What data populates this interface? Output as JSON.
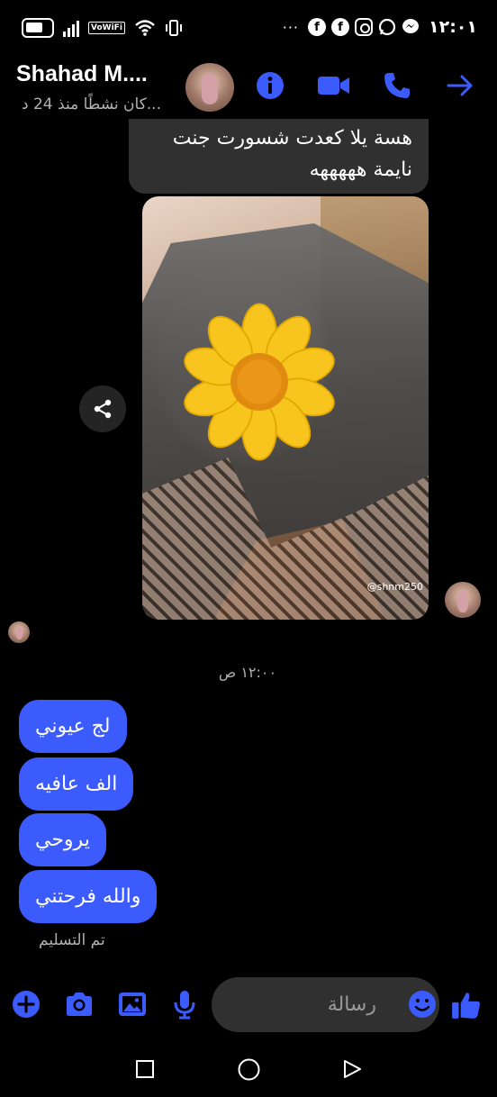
{
  "status_bar": {
    "vowifi": "VoWiFi",
    "time": "١٢:٠١",
    "dots": "···",
    "app_icons": [
      "facebook-icon",
      "facebook-icon",
      "instagram-icon",
      "whatsapp-icon",
      "messenger-icon"
    ]
  },
  "header": {
    "contact_name": "Shahad M....",
    "active_status": "كان نشطًا منذ 24 د...",
    "accent_color": "#3b5bfc"
  },
  "messages": {
    "incoming_text": "هسة يلا كعدت شسورت جنت نايمة هههههه",
    "photo_watermark": "@shnm250",
    "timestamp": "١٢:٠٠ ص",
    "outgoing": [
      "لج عيوني",
      "الف عافيه",
      "يروحي",
      "والله فرحتني"
    ],
    "delivered_label": "تم التسليم"
  },
  "composer": {
    "placeholder": "رسالة"
  },
  "colors": {
    "background": "#000000",
    "incoming_bubble": "#303030",
    "outgoing_bubble": "#3b5bfc"
  }
}
